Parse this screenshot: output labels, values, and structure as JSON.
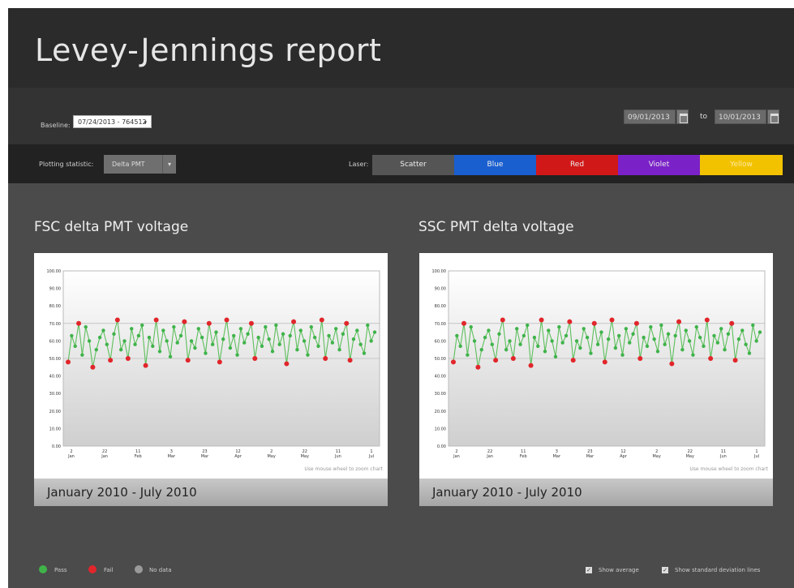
{
  "header": {
    "title": "Levey-Jennings report"
  },
  "baseline": {
    "label": "Baseline:",
    "value": "07/24/2013 - 764512"
  },
  "date_range": {
    "from": "09/01/2013",
    "to_label": "to",
    "to": "10/01/2013"
  },
  "filters": {
    "plotting_label": "Plotting statistic:",
    "plotting_value": "Delta PMT",
    "laser_label": "Laser:",
    "lasers": [
      "Scatter",
      "Blue",
      "Red",
      "Violet",
      "Yellow"
    ],
    "colors": {
      "scatter": "#555555",
      "blue": "#1a5fd0",
      "red": "#d01818",
      "violet": "#7a22c8",
      "yellow": "#f2c200"
    }
  },
  "charts": [
    {
      "title": "FSC delta PMT voltage",
      "footer": "January 2010 - July 2010",
      "hint": "Use mouse wheel to zoom chart"
    },
    {
      "title": "SSC PMT delta voltage",
      "footer": "January 2010 - July 2010",
      "hint": "Use mouse wheel to zoom chart"
    }
  ],
  "chart_data": [
    {
      "type": "line",
      "title": "FSC delta PMT voltage",
      "ylim": [
        0,
        100
      ],
      "y_ticks": [
        "100.00",
        "90.00",
        "80.00",
        "70.00",
        "60.00",
        "50.00",
        "40.00",
        "30.00",
        "20.00",
        "10.00",
        "0.00"
      ],
      "x_ticks": [
        [
          "2",
          "Jan"
        ],
        [
          "22",
          "Jan"
        ],
        [
          "11",
          "Feb"
        ],
        [
          "3",
          "Mar"
        ],
        [
          "23",
          "Mar"
        ],
        [
          "12",
          "Apr"
        ],
        [
          "2",
          "May"
        ],
        [
          "22",
          "May"
        ],
        [
          "11",
          "Jun"
        ],
        [
          "1",
          "Jul"
        ]
      ],
      "series": [
        {
          "values": [
            48,
            63,
            57,
            70,
            52,
            68,
            60,
            45,
            55,
            62,
            66,
            58,
            49,
            64,
            72,
            55,
            60,
            50,
            67,
            58,
            63,
            69,
            46,
            62,
            57,
            72,
            54,
            66,
            60,
            51,
            68,
            59,
            63,
            71,
            49,
            60,
            56,
            67,
            62,
            53,
            70,
            58,
            65,
            48,
            61,
            72,
            56,
            63,
            52,
            67,
            59,
            64,
            70,
            50,
            62,
            57,
            68,
            61,
            54,
            69,
            58,
            64,
            47,
            63,
            71,
            55,
            66,
            60,
            52,
            68,
            62,
            57,
            72,
            50,
            63,
            59,
            67,
            55,
            64,
            70,
            49,
            61,
            66,
            58,
            53,
            69,
            60,
            65
          ]
        }
      ],
      "limits": {
        "upper": 70,
        "lower": 50
      },
      "point_colors": {
        "pass": "#3fb34a",
        "fail": "#e1262b"
      }
    },
    {
      "type": "line",
      "title": "SSC PMT delta voltage",
      "ylim": [
        0,
        100
      ],
      "y_ticks": [
        "100.00",
        "90.00",
        "80.00",
        "70.00",
        "60.00",
        "50.00",
        "40.00",
        "30.00",
        "20.00",
        "10.00",
        "0.00"
      ],
      "x_ticks": [
        [
          "2",
          "Jan"
        ],
        [
          "22",
          "Jan"
        ],
        [
          "11",
          "Feb"
        ],
        [
          "3",
          "Mar"
        ],
        [
          "23",
          "Mar"
        ],
        [
          "12",
          "Apr"
        ],
        [
          "2",
          "May"
        ],
        [
          "22",
          "May"
        ],
        [
          "11",
          "Jun"
        ],
        [
          "1",
          "Jul"
        ]
      ],
      "series": [
        {
          "values": [
            48,
            63,
            57,
            70,
            52,
            68,
            60,
            45,
            55,
            62,
            66,
            58,
            49,
            64,
            72,
            55,
            60,
            50,
            67,
            58,
            63,
            69,
            46,
            62,
            57,
            72,
            54,
            66,
            60,
            51,
            68,
            59,
            63,
            71,
            49,
            60,
            56,
            67,
            62,
            53,
            70,
            58,
            65,
            48,
            61,
            72,
            56,
            63,
            52,
            67,
            59,
            64,
            70,
            50,
            62,
            57,
            68,
            61,
            54,
            69,
            58,
            64,
            47,
            63,
            71,
            55,
            66,
            60,
            52,
            68,
            62,
            57,
            72,
            50,
            63,
            59,
            67,
            55,
            64,
            70,
            49,
            61,
            66,
            58,
            53,
            69,
            60,
            65
          ]
        }
      ],
      "limits": {
        "upper": 70,
        "lower": 50
      },
      "point_colors": {
        "pass": "#3fb34a",
        "fail": "#e1262b"
      }
    }
  ],
  "legend": {
    "pass": "Pass",
    "fail": "Fail",
    "nodata": "No data"
  },
  "options": {
    "show_average": "Show average",
    "show_sd": "Show standard deviation lines"
  }
}
